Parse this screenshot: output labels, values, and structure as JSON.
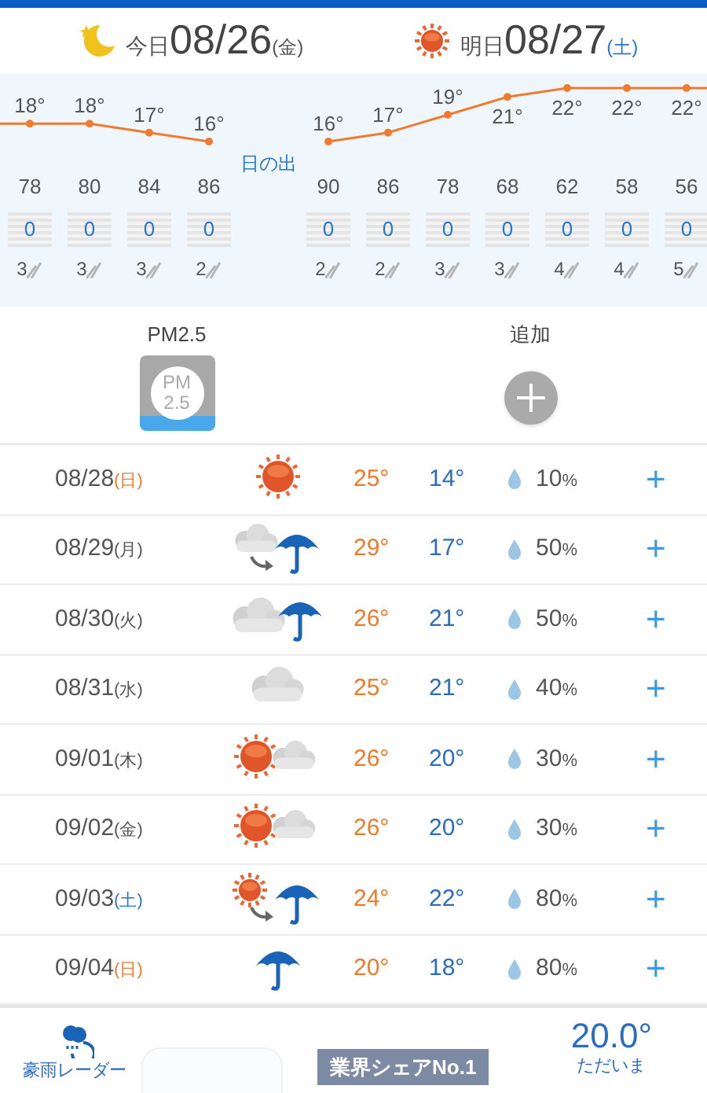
{
  "header": [
    {
      "kind": "moon",
      "label": "今日",
      "date": "08/26",
      "weekday": "(金)",
      "color": "#555555"
    },
    {
      "kind": "sun",
      "label": "明日",
      "date": "08/27",
      "weekday": "(土)",
      "color": "#2a78c8"
    }
  ],
  "hourly": [
    {
      "kind": "hour",
      "temp": "18°",
      "humidity": "78",
      "precip": "0",
      "wind": "3"
    },
    {
      "kind": "hour",
      "temp": "18°",
      "humidity": "80",
      "precip": "0",
      "wind": "3"
    },
    {
      "kind": "hour",
      "temp": "17°",
      "humidity": "84",
      "precip": "0",
      "wind": "3"
    },
    {
      "kind": "hour",
      "temp": "16°",
      "humidity": "86",
      "precip": "0",
      "wind": "2"
    },
    {
      "kind": "sunrise",
      "label": "日の出"
    },
    {
      "kind": "hour",
      "temp": "16°",
      "humidity": "90",
      "precip": "0",
      "wind": "2"
    },
    {
      "kind": "hour",
      "temp": "17°",
      "humidity": "86",
      "precip": "0",
      "wind": "2"
    },
    {
      "kind": "hour",
      "temp": "19°",
      "humidity": "78",
      "precip": "0",
      "wind": "3"
    },
    {
      "kind": "hour",
      "temp": "21°",
      "humidity": "68",
      "precip": "0",
      "wind": "3"
    },
    {
      "kind": "hour",
      "temp": "22°",
      "humidity": "62",
      "precip": "0",
      "wind": "4"
    },
    {
      "kind": "hour",
      "temp": "22°",
      "humidity": "58",
      "precip": "0",
      "wind": "4"
    },
    {
      "kind": "hour",
      "temp": "22°",
      "humidity": "56",
      "precip": "0",
      "wind": "5"
    }
  ],
  "widgets": [
    {
      "kind": "pm25",
      "label": "PM2.5",
      "icon_text": [
        "PM",
        "2.5"
      ]
    },
    {
      "kind": "add",
      "label": "追加"
    }
  ],
  "daily": [
    {
      "date": "08/28",
      "weekday": "(日)",
      "color": "#f07a2a",
      "kind": "sunny",
      "high": "25°",
      "low": "14°",
      "rain": "10",
      "unit": "%",
      "plus": "+"
    },
    {
      "date": "08/29",
      "weekday": "(月)",
      "color": "#555555",
      "kind": "cloudy_then_rain",
      "high": "29°",
      "low": "17°",
      "rain": "50",
      "unit": "%",
      "plus": "+"
    },
    {
      "date": "08/30",
      "weekday": "(火)",
      "color": "#555555",
      "kind": "cloudy_rain",
      "high": "26°",
      "low": "21°",
      "rain": "50",
      "unit": "%",
      "plus": "+"
    },
    {
      "date": "08/31",
      "weekday": "(水)",
      "color": "#555555",
      "kind": "cloudy",
      "high": "25°",
      "low": "21°",
      "rain": "40",
      "unit": "%",
      "plus": "+"
    },
    {
      "date": "09/01",
      "weekday": "(木)",
      "color": "#555555",
      "kind": "sunny_cloudy",
      "high": "26°",
      "low": "20°",
      "rain": "30",
      "unit": "%",
      "plus": "+"
    },
    {
      "date": "09/02",
      "weekday": "(金)",
      "color": "#555555",
      "kind": "sunny_cloudy",
      "high": "26°",
      "low": "20°",
      "rain": "30",
      "unit": "%",
      "plus": "+"
    },
    {
      "date": "09/03",
      "weekday": "(土)",
      "color": "#2a78c8",
      "kind": "sunny_then_rain",
      "high": "24°",
      "low": "22°",
      "rain": "80",
      "unit": "%",
      "plus": "+"
    },
    {
      "date": "09/04",
      "weekday": "(日)",
      "color": "#f07a2a",
      "kind": "rain",
      "high": "20°",
      "low": "18°",
      "rain": "80",
      "unit": "%",
      "plus": "+"
    }
  ],
  "footer": {
    "radar_label": "豪雨レーダー",
    "ad_text": "業界シェアNo.1",
    "current_temp": "20.0°",
    "current_label": "ただいま"
  }
}
